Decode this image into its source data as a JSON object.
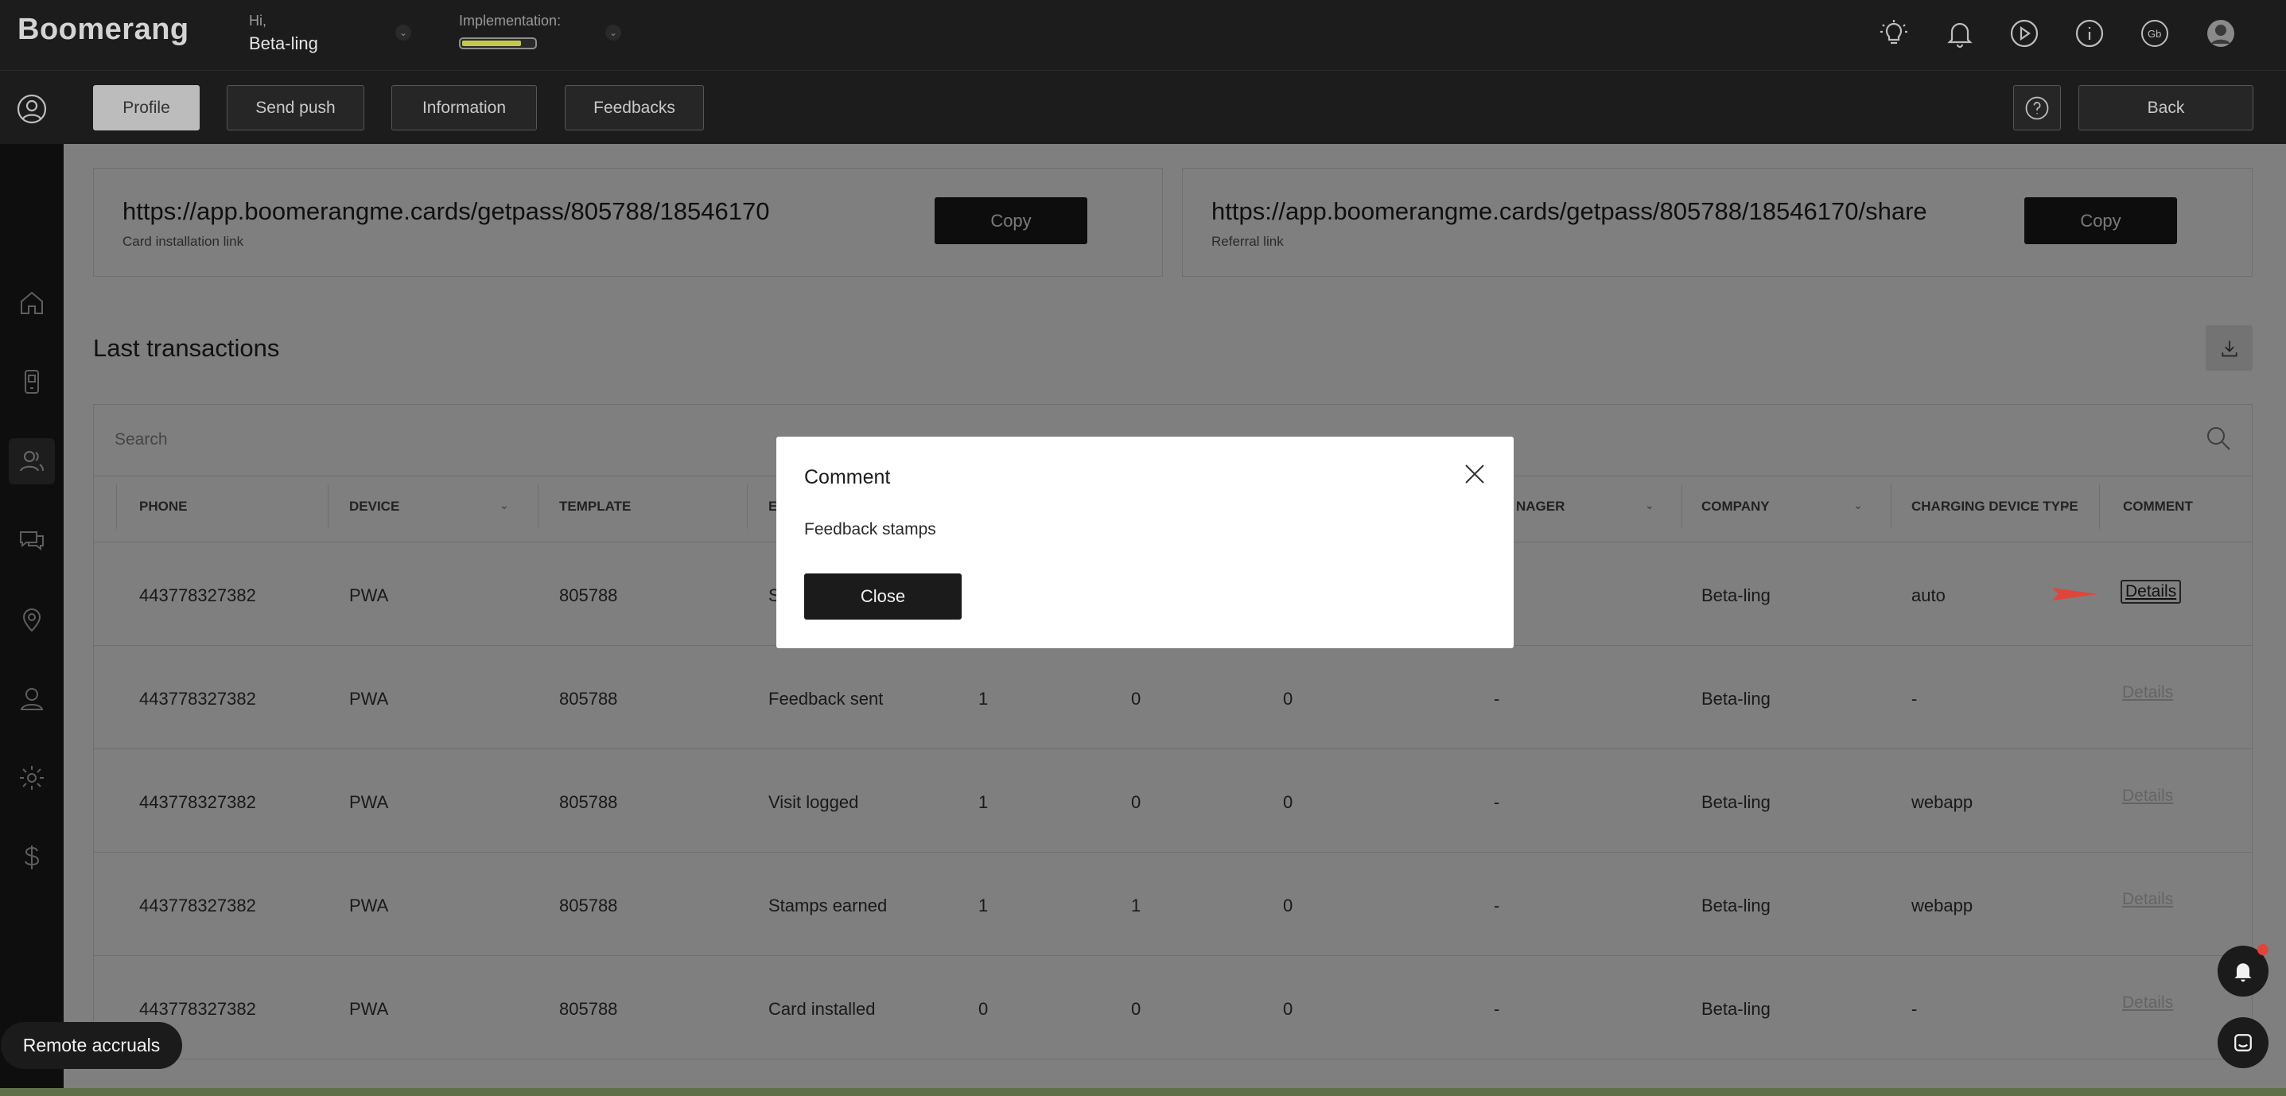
{
  "app": {
    "logo": "Boomerang"
  },
  "header": {
    "greeting": "Hi,",
    "user_name": "Beta-ling",
    "implementation_label": "Implementation:",
    "implementation_progress": 0.82
  },
  "navbar": {
    "tabs": [
      {
        "label": "Profile",
        "active": true
      },
      {
        "label": "Send push",
        "active": false
      },
      {
        "label": "Information",
        "active": false
      },
      {
        "label": "Feedbacks",
        "active": false
      }
    ],
    "back_label": "Back"
  },
  "links": {
    "install": {
      "url": "https://app.boomerangme.cards/getpass/805788/18546170",
      "caption": "Card installation link",
      "copy_label": "Copy"
    },
    "referral": {
      "url": "https://app.boomerangme.cards/getpass/805788/18546170/share",
      "caption": "Referral link",
      "copy_label": "Copy"
    }
  },
  "transactions": {
    "title": "Last transactions",
    "search_placeholder": "Search",
    "columns": [
      "PHONE",
      "DEVICE",
      "TEMPLATE",
      "E",
      "NAGER",
      "COMPANY",
      "CHARGING DEVICE TYPE",
      "COMMENT"
    ],
    "details_label": "Details",
    "rows": [
      {
        "phone": "443778327382",
        "device": "PWA",
        "template": "805788",
        "event": "S",
        "a": "",
        "b": "",
        "c": "",
        "manager": "",
        "company": "Beta-ling",
        "charging": "auto"
      },
      {
        "phone": "443778327382",
        "device": "PWA",
        "template": "805788",
        "event": "Feedback sent",
        "a": "1",
        "b": "0",
        "c": "0",
        "manager": "-",
        "company": "Beta-ling",
        "charging": "-"
      },
      {
        "phone": "443778327382",
        "device": "PWA",
        "template": "805788",
        "event": "Visit logged",
        "a": "1",
        "b": "0",
        "c": "0",
        "manager": "-",
        "company": "Beta-ling",
        "charging": "webapp"
      },
      {
        "phone": "443778327382",
        "device": "PWA",
        "template": "805788",
        "event": "Stamps earned",
        "a": "1",
        "b": "1",
        "c": "0",
        "manager": "-",
        "company": "Beta-ling",
        "charging": "webapp"
      },
      {
        "phone": "443778327382",
        "device": "PWA",
        "template": "805788",
        "event": "Card installed",
        "a": "0",
        "b": "0",
        "c": "0",
        "manager": "-",
        "company": "Beta-ling",
        "charging": "-"
      }
    ]
  },
  "modal": {
    "title": "Comment",
    "text": "Feedback stamps",
    "close_label": "Close"
  },
  "widgets": {
    "remote_label": "Remote accruals"
  },
  "colors": {
    "dark": "#1c1c1c",
    "accent_progress": "#c4c94a",
    "annotation_arrow": "#e0453c"
  }
}
